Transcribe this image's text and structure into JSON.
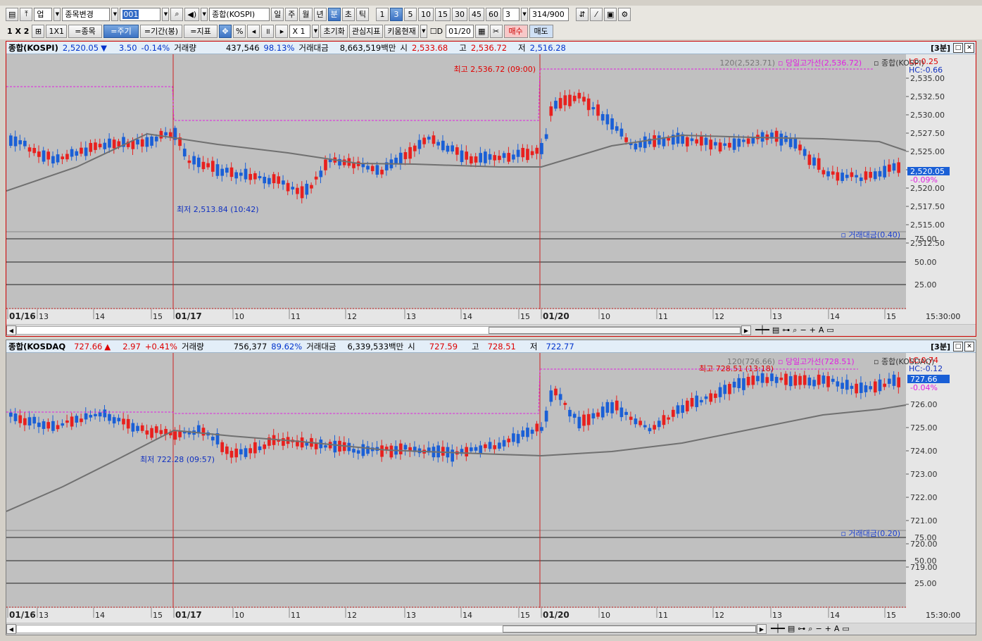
{
  "toolbar1": {
    "market_type": "업",
    "item_change_label": "종목변경",
    "code": "001",
    "symbol_name": "종합(KOSPI)",
    "period_buttons": [
      "일",
      "주",
      "월",
      "년",
      "분",
      "초",
      "틱"
    ],
    "active_period": "분",
    "minute_buttons": [
      "1",
      "3",
      "5",
      "10",
      "15",
      "30",
      "45",
      "60"
    ],
    "active_minute": "3",
    "count_value": "3",
    "range_text": "314/900"
  },
  "toolbar2": {
    "layout_label": "1 X 2",
    "layout_1x1": "1X1",
    "item_btn": "=종목",
    "period_btn": "=주기",
    "range_btn": "=기간(봉)",
    "indicator_btn": "=지표",
    "percent_btn": "%",
    "zoom_value": "X 1",
    "reset_btn": "초기화",
    "watch_btn": "관심지표",
    "kiwoom_btn": "키움현재",
    "date_check_label": "D",
    "date_value": "01/20",
    "buy_btn": "매수",
    "sell_btn": "매도"
  },
  "panel1": {
    "name": "종합(KOSPI)",
    "price": "2,520.05",
    "change_arrow": "▼",
    "change": "3.50",
    "change_pct": "-0.14%",
    "volume_label": "거래량",
    "volume": "437,546",
    "volume_ratio": "98.13%",
    "amount_label": "거래대금",
    "amount": "8,663,519백만",
    "open_label": "시",
    "open": "2,533.68",
    "high_label": "고",
    "high": "2,536.72",
    "low_label": "저",
    "low": "2,516.28",
    "interval_label": "[3분]",
    "ma_label": "120(2,523.71)",
    "day_high_line_label": "당일고가선(2,536.72)",
    "legend_symbol": "종합(KOSPI)",
    "lc": "LC:0.25",
    "hc": "HC:-0.66",
    "current_price_tag": "2,520.05",
    "current_pct_tag": "-0.09%",
    "max_label": "최고 2,536.72 (09:00)",
    "min_label": "최저 2,513.84 (10:42)",
    "y_ticks": [
      "2,535.00",
      "2,532.50",
      "2,530.00",
      "2,527.50",
      "2,525.00",
      "2,522.50",
      "2,520.00",
      "2,517.50",
      "2,515.00",
      "2,512.50"
    ],
    "sub_label": "거래대금(0.40)",
    "sub_ticks": [
      "75.00",
      "50.00",
      "25.00"
    ],
    "x_labels": [
      "01/16",
      "13",
      "14",
      "15",
      "01/17",
      "10",
      "11",
      "12",
      "13",
      "14",
      "15",
      "01/20",
      "10",
      "11",
      "12",
      "13",
      "14",
      "15"
    ],
    "time_label": "15:30:00"
  },
  "panel2": {
    "name": "종합(KOSDAQ",
    "price": "727.66",
    "change_arrow": "▲",
    "change": "2.97",
    "change_pct": "+0.41%",
    "volume_label": "거래량",
    "volume": "756,377",
    "volume_ratio": "89.62%",
    "amount_label": "거래대금",
    "amount": "6,339,533백만",
    "open_label": "시",
    "open": "727.59",
    "high_label": "고",
    "high": "728.51",
    "low_label": "저",
    "low": "722.77",
    "interval_label": "[3분]",
    "ma_label": "120(726.66)",
    "day_high_line_label": "당일고가선(728.51)",
    "legend_symbol": "종합(KOSDAQ)",
    "lc": "LC:0.74",
    "hc": "HC:-0.12",
    "current_price_tag": "727.66",
    "current_pct_tag": "-0.04%",
    "max_label": "최고 728.51 (13:18)",
    "min_label": "최저 722.28 (09:57)",
    "y_ticks": [
      "726.00",
      "725.00",
      "724.00",
      "723.00",
      "722.00",
      "721.00",
      "720.00",
      "719.00"
    ],
    "sub_label": "거래대금(0.20)",
    "sub_ticks": [
      "75.00",
      "50.00",
      "25.00"
    ],
    "x_labels": [
      "01/16",
      "13",
      "14",
      "15",
      "01/17",
      "10",
      "11",
      "12",
      "13",
      "14",
      "15",
      "01/20",
      "10",
      "11",
      "12",
      "13",
      "14",
      "15"
    ],
    "time_label": "15:30:00"
  },
  "colors": {
    "up": "#e8201e",
    "down": "#1a5fd6",
    "ma": "#707070",
    "high_line": "#e020e0",
    "divider": "#cc2222",
    "chart_bg": "#c0c0c0"
  }
}
